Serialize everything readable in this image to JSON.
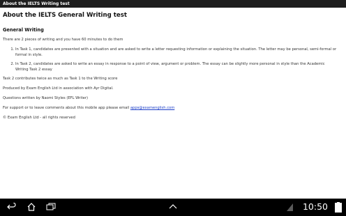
{
  "window": {
    "title": "About the IELTS Writing test"
  },
  "main": {
    "title": "About the IELTS General Writing test",
    "section_heading": "General Writing",
    "intro": "There are 2 pieces of writing and you have 60 minutes to do them",
    "tasks": [
      "In Task 1, candidates are presented with a situation and are asked to write a letter requesting information or explaining the situation. The letter may be personal, semi-formal or formal in style.",
      "In Task 2, candidates are asked to write an essay in response to a point of view, argument or problem. The essay can be slightly more personal in style than the Academic Writing Task 2 essay"
    ],
    "task2_note": "Task 2 contributes twice as much as Task 1 to the Writing score",
    "produced_by": "Produced by Exam English Ltd in association with Ayr Digital.",
    "questions_by": "Questions written by Naomi Styles (EFL Writer)",
    "support_text": "For support or to leave comments about this mobile app please email ",
    "support_email": "apps@examenglish.com",
    "copyright": "© Exam English Ltd - all rights reserved"
  },
  "status_bar": {
    "time": "10:50",
    "icons": [
      "back-icon",
      "home-icon",
      "recent-apps-icon",
      "up-arrow-icon",
      "signal-icon",
      "battery-icon"
    ]
  },
  "colors": {
    "title_bar": "#1e1e1e",
    "nav_bar": "#000000",
    "link": "#1a3cc8",
    "battery": "#ffffff"
  }
}
